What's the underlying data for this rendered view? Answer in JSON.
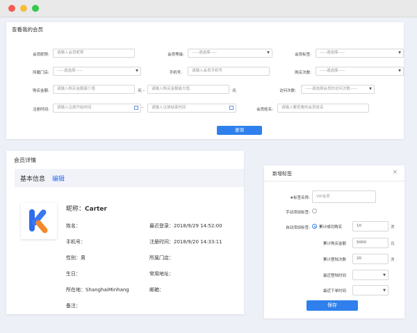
{
  "search": {
    "title": "查看我的会员",
    "fields": [
      {
        "label": "会员昵称:",
        "value": "请输入会员昵称"
      },
      {
        "label": "会员等级:",
        "value": "-----请选择-----"
      },
      {
        "label": "会员标签:",
        "value": "-----请选择-----"
      },
      {
        "label": "所属门店:",
        "value": "-----请选择-----"
      },
      {
        "label": "手机号:",
        "value": "请输入会员手机号"
      },
      {
        "label": "购买次数:",
        "value": "-----请选择-----"
      },
      {
        "label": "购买金额:",
        "value_min": "请输入购买金额最少值",
        "value_max": "请输入购买金额最大值",
        "unit": "元",
        "dash": "元 -"
      },
      {
        "label": "访问次数:",
        "value": "-----请选择会员的访问次数-----"
      },
      {
        "label": "注册时间:",
        "value_start": "请输入注册开始时间",
        "value_end": "请输入注册结束时间",
        "dash": "-"
      },
      {
        "label": "会员姓名:",
        "value": "请输入要查看的会员姓名"
      }
    ],
    "query_button": "查询"
  },
  "detail": {
    "title": "会员详情",
    "section_title": "基本信息",
    "edit_link": "编辑",
    "nickname_label": "昵称：",
    "nickname": "Carter",
    "rows": [
      {
        "left": "姓名：",
        "right": "最近登录：2018/9/29 14:52:00"
      },
      {
        "left": "手机号：",
        "right": "注册时间：2018/9/20 14:33:11"
      },
      {
        "left": "性别：男",
        "right": "所属门店："
      },
      {
        "left": "生日：",
        "right": "常用地址："
      },
      {
        "left": "所在地：ShanghaiMinhang",
        "right": "邮箱："
      },
      {
        "left": "备注：",
        "right": ""
      }
    ],
    "logo_colors": {
      "blue": "#2f6bed",
      "orange": "#f28a2b"
    }
  },
  "tag_dialog": {
    "title": "新增标签",
    "close_icon": "×",
    "name_label": "★标签名称:",
    "name_value": "VIP会员",
    "manual_label": "手动添加标签:",
    "auto_label": "自动添加标签:",
    "auto_option": "累计成功购买",
    "auto_value": "10",
    "auto_unit": "次",
    "conditions": [
      {
        "label": "累计购买金额",
        "value": "5000",
        "unit": "元",
        "type": "input"
      },
      {
        "label": "累计登陆次数",
        "value": "20",
        "unit": "次",
        "type": "input"
      },
      {
        "label": "最近登陆时间",
        "value": "",
        "unit": "",
        "type": "select"
      },
      {
        "label": "最近下单时间",
        "value": "",
        "unit": "",
        "type": "select"
      }
    ],
    "save_button": "保存"
  },
  "colors": {
    "accent": "#2f80ed",
    "background": "#eef0f8"
  }
}
